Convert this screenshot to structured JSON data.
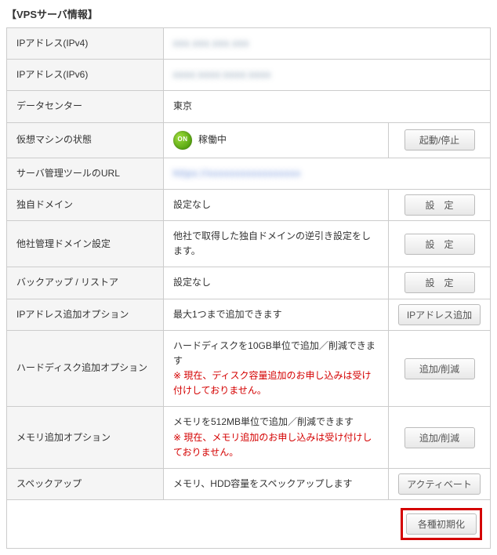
{
  "title": "【VPSサーバ情報】",
  "on_icon_text": "ON",
  "rows": {
    "ipv4": {
      "label": "IPアドレス(IPv4)",
      "value": "xxx.xxx.xxx.xxx"
    },
    "ipv6": {
      "label": "IPアドレス(IPv6)",
      "value": "xxxx:xxxx:xxxx:xxxx"
    },
    "datacenter": {
      "label": "データセンター",
      "value": "東京"
    },
    "vm_status": {
      "label": "仮想マシンの状態",
      "value": "稼働中",
      "button": "起動/停止"
    },
    "mgmt_url": {
      "label": "サーバ管理ツールのURL",
      "value": "https://xxxxxxxxxxxxxxxxx"
    },
    "own_domain": {
      "label": "独自ドメイン",
      "value": "設定なし",
      "button": "設　定"
    },
    "other_domain": {
      "label": "他社管理ドメイン設定",
      "value": "他社で取得した独自ドメインの逆引き設定をします。",
      "button": "設　定"
    },
    "backup": {
      "label": "バックアップ / リストア",
      "value": "設定なし",
      "button": "設　定"
    },
    "ip_add": {
      "label": "IPアドレス追加オプション",
      "value": "最大1つまで追加できます",
      "button": "IPアドレス追加"
    },
    "hdd_add": {
      "label": "ハードディスク追加オプション",
      "value_line1": "ハードディスクを10GB単位で追加／削減できます",
      "value_note": "※ 現在、ディスク容量追加のお申し込みは受け付けしておりません。",
      "button": "追加/削減"
    },
    "mem_add": {
      "label": "メモリ追加オプション",
      "value_line1": "メモリを512MB単位で追加／削減できます",
      "value_note": "※ 現在、メモリ追加のお申し込みは受け付けしておりません。",
      "button": "追加/削減"
    },
    "specup": {
      "label": "スペックアップ",
      "value": "メモリ、HDD容量をスペックアップします",
      "button": "アクティベート"
    },
    "footer": {
      "button": "各種初期化"
    }
  }
}
